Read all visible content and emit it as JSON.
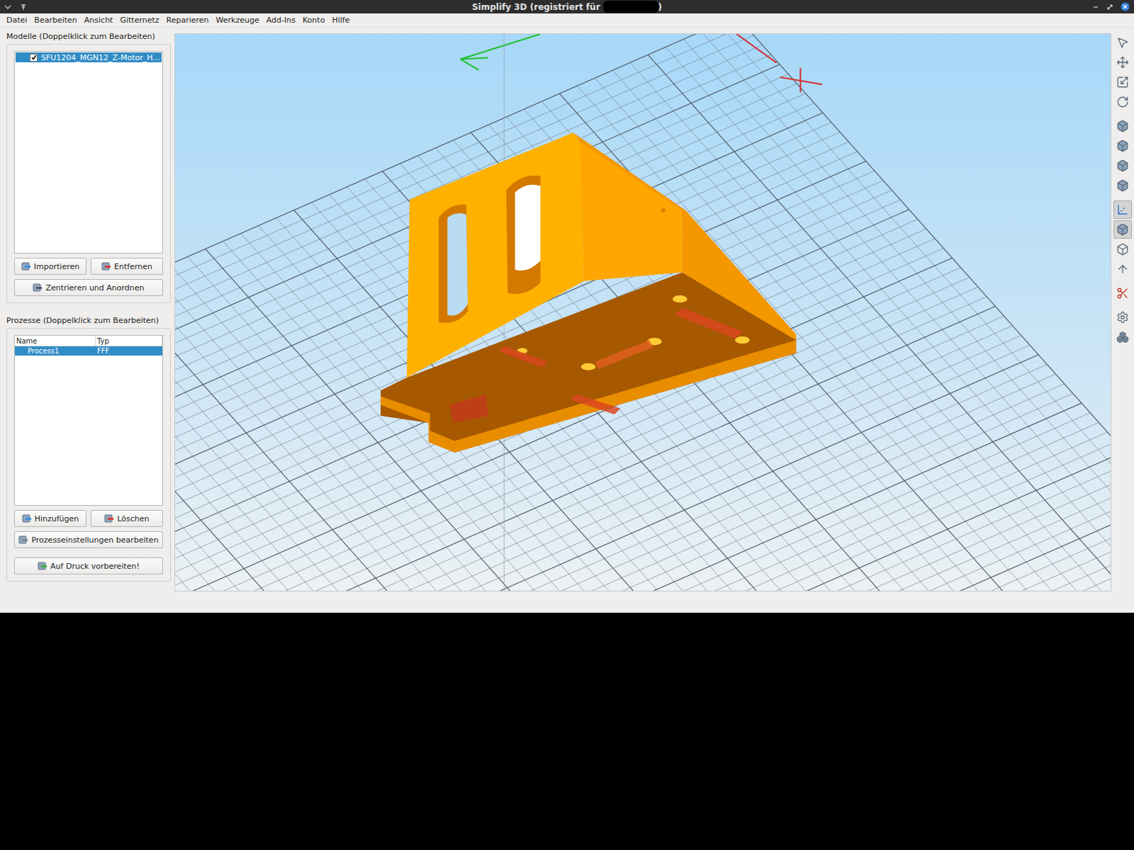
{
  "window": {
    "title": "Simplify 3D (registriert für",
    "title_end": ")",
    "redacted": true
  },
  "menu": [
    "Datei",
    "Bearbeiten",
    "Ansicht",
    "Gitternetz",
    "Reparieren",
    "Werkzeuge",
    "Add-Ins",
    "Konto",
    "Hilfe"
  ],
  "models": {
    "label": "Modelle (Doppelklick zum Bearbeiten)",
    "items": [
      {
        "name": "SFU1204_MGN12_Z-Motor_H...",
        "checked": true,
        "selected": true
      }
    ],
    "buttons": [
      "Importieren",
      "Entfernen"
    ],
    "center_button": "Zentrieren und Anordnen"
  },
  "processes": {
    "label": "Prozesse (Doppelklick zum Bearbeiten)",
    "columns": [
      "Name",
      "Typ"
    ],
    "rows": [
      {
        "name": "Process1",
        "type": "FFF",
        "selected": true
      }
    ],
    "buttons": [
      "Hinzufügen",
      "Löschen"
    ],
    "edit_button": "Prozesseinstellungen bearbeiten",
    "prepare_button": "Auf Druck vorbereiten!"
  },
  "toolbar": [
    {
      "kind": "select",
      "selected": false
    },
    {
      "kind": "move",
      "selected": false
    },
    {
      "kind": "scale",
      "selected": false
    },
    {
      "kind": "rotate",
      "selected": false
    },
    {
      "kind": "view",
      "selected": false
    },
    {
      "kind": "view",
      "selected": false
    },
    {
      "kind": "view",
      "selected": false
    },
    {
      "kind": "view",
      "selected": false
    },
    {
      "kind": "axes",
      "selected": true
    },
    {
      "kind": "solid",
      "selected": true
    },
    {
      "kind": "wire",
      "selected": false
    },
    {
      "kind": "normals",
      "selected": false
    },
    {
      "kind": "section",
      "selected": false
    },
    {
      "kind": "settings",
      "selected": false
    },
    {
      "kind": "objects",
      "selected": false
    }
  ]
}
